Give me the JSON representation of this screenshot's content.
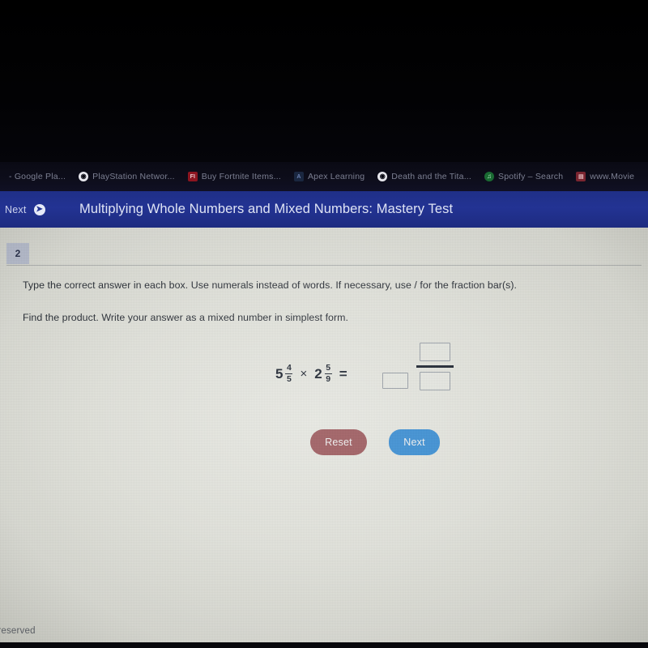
{
  "browser": {
    "bookmarks": [
      {
        "label": "- Google Pla...",
        "icon": "plain-icon"
      },
      {
        "label": "PlayStation Networ...",
        "icon": "playstation-icon",
        "glyph": "◉"
      },
      {
        "label": "Buy Fortnite Items...",
        "icon": "epic-games-icon",
        "glyph": "FI"
      },
      {
        "label": "Apex Learning",
        "icon": "apex-learning-icon",
        "glyph": "A"
      },
      {
        "label": "Death and the Tita...",
        "icon": "globe-icon",
        "glyph": "◉"
      },
      {
        "label": "Spotify – Search",
        "icon": "spotify-icon",
        "glyph": "♫"
      },
      {
        "label": "www.Movie",
        "icon": "movie-icon",
        "glyph": "▤"
      }
    ]
  },
  "header": {
    "next_label": "Next",
    "next_icon": "arrow-right-circle-icon",
    "title": "Multiplying Whole Numbers and Mixed Numbers: Mastery Test",
    "background_color": "#233393"
  },
  "question": {
    "number": "2",
    "instruction_1": "Type the correct answer in each box. Use numerals instead of words. If necessary, use / for the fraction bar(s).",
    "instruction_2": "Find the product. Write your answer as a mixed number in simplest form."
  },
  "expression": {
    "operand_1": {
      "whole": "5",
      "numerator": "4",
      "denominator": "5"
    },
    "operator": "×",
    "operand_2": {
      "whole": "2",
      "numerator": "5",
      "denominator": "9"
    },
    "equals": "="
  },
  "answer": {
    "whole_value": "",
    "whole_placeholder": "",
    "numerator_value": "",
    "numerator_placeholder": "",
    "denominator_value": "",
    "denominator_placeholder": ""
  },
  "buttons": {
    "reset_label": "Reset",
    "reset_color": "#9e5a5e",
    "next_label": "Next",
    "next_color": "#3b8fd4"
  },
  "footer": {
    "text": "hts reserved"
  }
}
